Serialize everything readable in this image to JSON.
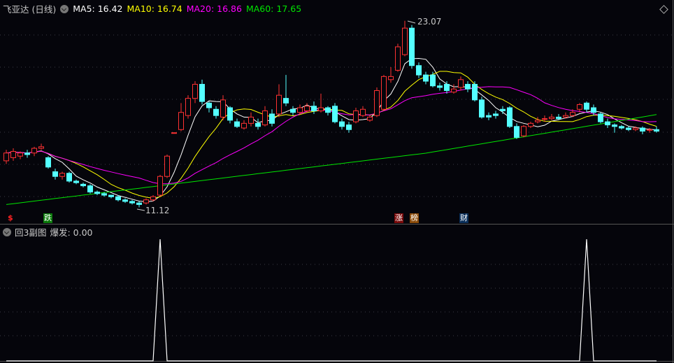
{
  "header": {
    "title": "飞亚达 (日线)",
    "ma5": "MA5: 16.42",
    "ma10": "MA10: 16.74",
    "ma20": "MA20: 16.86",
    "ma60": "MA60: 17.65"
  },
  "colors": {
    "up": "#ff3232",
    "down": "#54ffff",
    "ma5": "#ffffff",
    "ma10": "#ffff00",
    "ma20": "#ff00ff",
    "ma60": "#00e600"
  },
  "markers": {
    "dollar": "$",
    "fall": "跌",
    "limit_up": "涨",
    "board": "榜",
    "finance": "财"
  },
  "annotations": {
    "high": "23.07",
    "low": "11.12"
  },
  "sub": {
    "title": "回3副图",
    "value": "爆发: 0.00"
  },
  "chart_data": {
    "type": "candlestick",
    "ylim": [
      10.9,
      23.5
    ],
    "candles": [
      [
        14.1,
        14.6,
        14.8,
        13.9
      ],
      [
        14.3,
        14.7,
        14.9,
        14.1
      ],
      [
        14.4,
        14.6,
        14.7,
        14.2
      ],
      [
        14.6,
        14.5,
        14.8,
        14.3
      ],
      [
        14.6,
        14.9,
        15.0,
        14.4
      ],
      [
        14.9,
        15.0,
        15.2,
        14.8
      ],
      [
        14.3,
        13.7,
        14.4,
        13.6
      ],
      [
        13.4,
        13.1,
        13.6,
        12.9
      ],
      [
        13.1,
        13.3,
        13.4,
        12.9
      ],
      [
        13.3,
        12.8,
        13.4,
        12.7
      ],
      [
        12.8,
        12.7,
        12.9,
        12.6
      ],
      [
        12.6,
        12.5,
        12.7,
        12.4
      ],
      [
        12.5,
        12.1,
        12.6,
        12.0
      ],
      [
        12.1,
        12.0,
        12.2,
        11.9
      ],
      [
        12.0,
        11.9,
        12.1,
        11.8
      ],
      [
        11.9,
        11.8,
        11.9,
        11.7
      ],
      [
        11.8,
        11.6,
        11.9,
        11.5
      ],
      [
        11.6,
        11.5,
        11.7,
        11.4
      ],
      [
        11.5,
        11.4,
        11.6,
        11.3
      ],
      [
        11.4,
        11.3,
        11.5,
        11.12
      ],
      [
        11.4,
        11.6,
        11.7,
        11.3
      ],
      [
        11.6,
        11.8,
        11.9,
        11.5
      ],
      [
        11.9,
        13.1,
        13.2,
        11.8
      ],
      [
        13.1,
        14.4,
        14.5,
        13.0
      ],
      [
        15.9,
        15.9,
        15.9,
        15.9
      ],
      [
        16.1,
        17.2,
        17.8,
        16.0
      ],
      [
        17.0,
        18.1,
        18.3,
        16.8
      ],
      [
        18.1,
        19.0,
        19.2,
        17.8
      ],
      [
        19.0,
        17.9,
        19.3,
        17.7
      ],
      [
        17.8,
        17.5,
        17.9,
        17.2
      ],
      [
        17.4,
        17.0,
        17.6,
        16.8
      ],
      [
        16.9,
        18.0,
        18.3,
        16.7
      ],
      [
        17.5,
        16.7,
        17.6,
        16.5
      ],
      [
        16.6,
        16.3,
        16.8,
        16.2
      ],
      [
        16.2,
        16.5,
        16.7,
        16.1
      ],
      [
        16.5,
        16.9,
        17.2,
        16.3
      ],
      [
        16.5,
        16.3,
        16.8,
        16.1
      ],
      [
        16.4,
        17.3,
        17.6,
        16.3
      ],
      [
        17.1,
        16.5,
        17.4,
        16.3
      ],
      [
        17.1,
        18.3,
        19.0,
        16.9
      ],
      [
        18.1,
        17.8,
        19.6,
        17.6
      ],
      [
        17.4,
        17.2,
        17.6,
        17.0
      ],
      [
        17.2,
        17.5,
        17.7,
        17.1
      ],
      [
        17.3,
        17.6,
        17.8,
        17.2
      ],
      [
        17.6,
        17.3,
        17.9,
        17.1
      ],
      [
        17.3,
        17.5,
        18.4,
        17.2
      ],
      [
        17.5,
        17.2,
        17.6,
        17.0
      ],
      [
        17.6,
        16.6,
        17.8,
        16.5
      ],
      [
        16.6,
        16.3,
        16.8,
        16.1
      ],
      [
        16.4,
        16.1,
        16.6,
        15.9
      ],
      [
        16.6,
        17.3,
        17.5,
        16.5
      ],
      [
        17.0,
        17.4,
        17.6,
        16.9
      ],
      [
        16.7,
        16.9,
        17.0,
        16.6
      ],
      [
        17.0,
        18.6,
        18.8,
        16.9
      ],
      [
        17.4,
        19.5,
        19.6,
        17.3
      ],
      [
        19.3,
        19.5,
        20.1,
        19.1
      ],
      [
        19.9,
        21.4,
        21.6,
        19.8
      ],
      [
        20.9,
        22.6,
        23.07,
        20.8
      ],
      [
        22.6,
        20.2,
        22.8,
        20.0
      ],
      [
        20.2,
        19.6,
        20.4,
        19.4
      ],
      [
        19.6,
        19.2,
        19.8,
        19.0
      ],
      [
        19.6,
        18.9,
        19.8,
        18.8
      ],
      [
        18.9,
        18.8,
        19.1,
        18.6
      ],
      [
        19.0,
        18.6,
        19.2,
        18.4
      ],
      [
        18.5,
        18.7,
        19.0,
        18.4
      ],
      [
        18.8,
        19.3,
        19.5,
        18.6
      ],
      [
        19.0,
        18.7,
        19.2,
        18.5
      ],
      [
        19.0,
        18.0,
        19.2,
        17.9
      ],
      [
        18.0,
        16.9,
        18.2,
        16.8
      ],
      [
        17.0,
        16.9,
        17.2,
        16.7
      ],
      [
        17.1,
        17.0,
        17.3,
        16.8
      ],
      [
        17.4,
        17.3,
        17.6,
        17.1
      ],
      [
        17.5,
        16.3,
        17.6,
        16.2
      ],
      [
        16.3,
        15.6,
        16.5,
        15.5
      ],
      [
        15.7,
        16.3,
        16.4,
        15.6
      ],
      [
        16.3,
        16.5,
        16.6,
        16.2
      ],
      [
        16.6,
        16.7,
        16.9,
        16.5
      ],
      [
        16.8,
        16.8,
        17.0,
        16.6
      ],
      [
        16.8,
        16.9,
        17.1,
        16.7
      ],
      [
        16.9,
        16.8,
        17.1,
        16.7
      ],
      [
        16.9,
        17.0,
        17.2,
        16.8
      ],
      [
        17.0,
        17.2,
        17.4,
        16.9
      ],
      [
        17.4,
        17.7,
        17.8,
        17.2
      ],
      [
        17.8,
        17.4,
        17.9,
        17.2
      ],
      [
        17.5,
        17.2,
        17.7,
        17.0
      ],
      [
        17.1,
        16.6,
        17.2,
        16.5
      ],
      [
        16.6,
        16.4,
        16.8,
        16.2
      ],
      [
        16.4,
        16.3,
        16.5,
        15.9
      ],
      [
        16.3,
        16.2,
        16.4,
        16.1
      ],
      [
        16.2,
        16.1,
        16.3,
        16.0
      ],
      [
        16.1,
        16.2,
        16.3,
        16.0
      ],
      [
        16.2,
        16.0,
        16.3,
        15.8
      ],
      [
        16.1,
        16.1,
        16.2,
        15.9
      ],
      [
        16.1,
        16.0,
        16.3,
        15.9
      ]
    ],
    "burst_spikes": [
      22,
      83
    ]
  }
}
